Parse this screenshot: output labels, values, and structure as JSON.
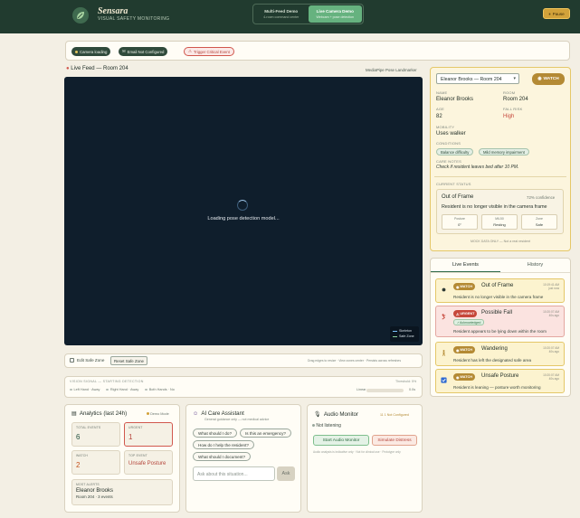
{
  "app": {
    "title": "Sensara",
    "subtitle": "VISUAL SAFETY MONITORING"
  },
  "modes": [
    {
      "label": "Multi-Feed Demo",
      "sub": "4-room command center"
    },
    {
      "label": "Live Camera Demo",
      "sub": "Webcam + pose detection"
    }
  ],
  "pause_label": "Pause",
  "toolbar": {
    "camera": "Camera loading",
    "email": "Email Not Configured",
    "trigger": "Trigger Critical Event"
  },
  "live": {
    "title": "Live Feed — Room 204",
    "model": "MediaPipe Pose Landmarker",
    "loading": "Loading pose detection model...",
    "legend": [
      "Skeleton",
      "Safe Zone"
    ]
  },
  "zone": {
    "edit_label": "Edit Safe Zone",
    "reset_label": "Reset Safe Zone",
    "hint": "Drag edges to resize · View zones center · Persists across refreshes"
  },
  "signals": {
    "title": "VISION SIGNAL — STARTING DETECTION",
    "right": "Threshold: 5%",
    "items": [
      "Left Hand · Away",
      "Right Hand · Away",
      "Both Hands · No"
    ],
    "linear_label": "Linear",
    "value": "0.0s"
  },
  "analytics": {
    "title": "Analytics (last 24h)",
    "mode": "Demo Mode",
    "total_label": "TOTAL EVENTS",
    "total": "6",
    "urgent_label": "URGENT",
    "urgent": "1",
    "watch_label": "WATCH",
    "watch": "2",
    "top_label": "TOP EVENT",
    "top": "Unsafe Posture",
    "most_label": "MOST ALERTS",
    "most_name": "Eleanor Brooks",
    "most_detail": "Room 204 · 3 events"
  },
  "assistant": {
    "title": "AI Care Assistant",
    "sub": "General guidance only — not medical advice",
    "prompts": [
      "What should I do?",
      "Is this an emergency?",
      "How do I help the resident?",
      "What should I document?"
    ],
    "placeholder": "Ask about this situation...",
    "ask": "Ask"
  },
  "audio": {
    "title": "Audio Monitor",
    "badge": "11 1 Not Configured",
    "status": "Not listening",
    "start": "Start Audio Monitor",
    "simulate": "Simulate Distress",
    "note": "Audio analysis is indicative only · Not for clinical use · Prototype only"
  },
  "resident": {
    "select": "Eleanor Brooks — Room 204",
    "watch": "WATCH",
    "name_label": "NAME",
    "name": "Eleanor Brooks",
    "room_label": "ROOM",
    "room": "Room 204",
    "age_label": "AGE",
    "age": "82",
    "risk_label": "FALL RISK",
    "risk": "High",
    "mobility_label": "MOBILITY",
    "mobility": "Uses walker",
    "conditions_label": "CONDITIONS",
    "conditions": [
      "Balance difficulty",
      "Mild memory impairment"
    ],
    "notes_label": "CARE NOTES",
    "notes": "Check if resident leaves bed after 10 PM.",
    "status_label": "CURRENT STATUS",
    "status_title": "Out of Frame",
    "status_conf": "72% confidence",
    "status_desc": "Resident is no longer visible in the camera frame",
    "metrics": [
      {
        "k": "Posture",
        "v": "0°"
      },
      {
        "k": "MIL50",
        "v": "Resting"
      },
      {
        "k": "Zone",
        "v": "Safe"
      }
    ],
    "mock": "MOCK DATA ONLY — Not a real resident"
  },
  "events": {
    "tabs": [
      "Live Events",
      "History"
    ],
    "items": [
      {
        "badge": "WATCH",
        "title": "Out of Frame",
        "time1": "10:19:41 AM",
        "time2": "just now",
        "desc": "Resident is no longer visible in the camera frame",
        "icon": "camera-off-icon",
        "color": "#2f3b35"
      },
      {
        "badge": "URGENT",
        "title": "Possible Fall",
        "time1": "10:20:07 AM",
        "time2": "40s ago",
        "ack": "Acknowledged",
        "desc": "Resident appears to be lying down within the room",
        "icon": "fall-icon",
        "color": "#c6463a"
      },
      {
        "badge": "WATCH",
        "title": "Wandering",
        "time1": "10:20:07 AM",
        "time2": "40s ago",
        "desc": "Resident has left the designated safe area",
        "icon": "walking-icon",
        "color": "#b48a34"
      },
      {
        "badge": "WATCH",
        "title": "Unsafe Posture",
        "time1": "10:20:07 AM",
        "time2": "40s ago",
        "desc": "Resident is leaning — posture worth monitoring",
        "icon": "posture-icon",
        "color": "#2f6ad1"
      }
    ]
  }
}
